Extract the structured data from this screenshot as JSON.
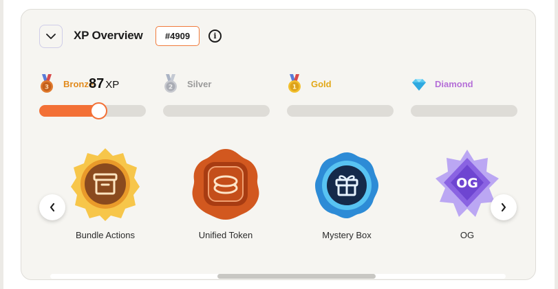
{
  "header": {
    "title": "XP Overview",
    "id_badge": "#4909",
    "info_icon": "info-icon",
    "collapse_icon": "chevron-down-icon"
  },
  "xp": {
    "value": "87",
    "unit": "XP"
  },
  "tiers": [
    {
      "label": "Bronze",
      "icon": "bronze-medal-icon",
      "color": "#e28a1c",
      "progress": 0.56
    },
    {
      "label": "Silver",
      "icon": "silver-medal-icon",
      "color": "#9a9a9a",
      "progress": 0
    },
    {
      "label": "Gold",
      "icon": "gold-medal-icon",
      "color": "#e2a818",
      "progress": 0
    },
    {
      "label": "Diamond",
      "icon": "diamond-icon",
      "color": "#b56fd8",
      "progress": 0
    }
  ],
  "badges": [
    {
      "label": "Bundle Actions",
      "icon": "archive-box-icon",
      "color": "#f4b43a"
    },
    {
      "label": "Unified Token",
      "icon": "coins-icon",
      "color": "#c9521e"
    },
    {
      "label": "Mystery Box",
      "icon": "gift-icon",
      "color": "#2a86d1"
    },
    {
      "label": "OG",
      "icon": "og-badge-icon",
      "color": "#8f67e0",
      "text": "OG"
    }
  ],
  "carousel": {
    "prev_icon": "chevron-left-icon",
    "next_icon": "chevron-right-icon"
  },
  "accent_color": "#f37036"
}
